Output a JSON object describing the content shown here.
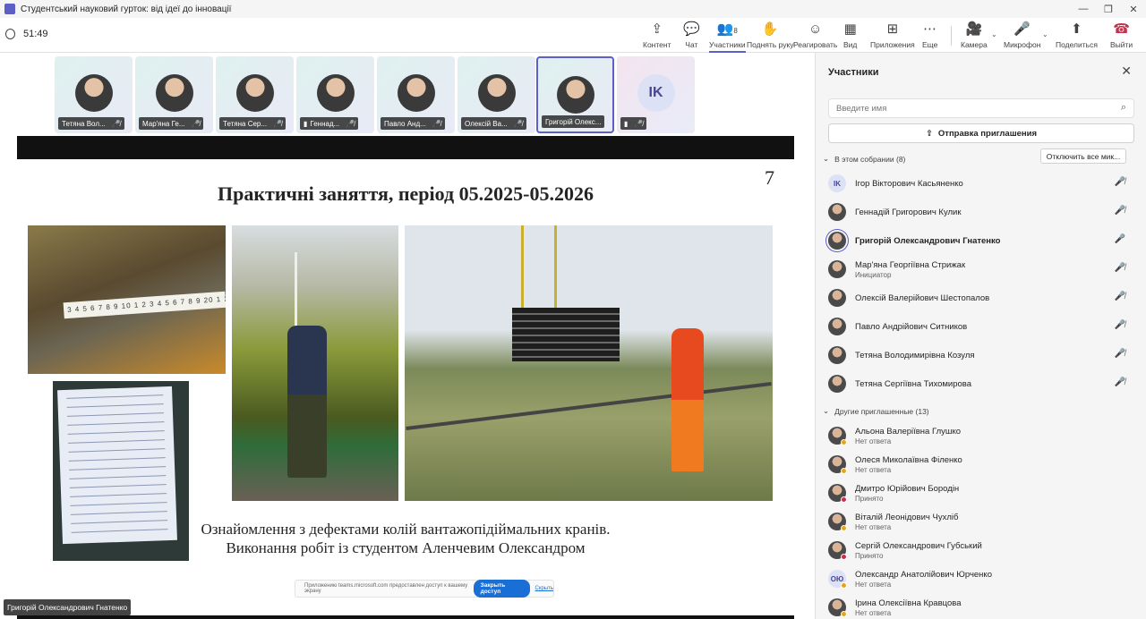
{
  "window": {
    "title": "Студентський науковий гурток: від ідеї до інновації",
    "controls": [
      "—",
      "❐",
      "✕"
    ]
  },
  "toolbar": {
    "timer": "51:49",
    "buttons": [
      {
        "label": "Контент",
        "icon": "⇪"
      },
      {
        "label": "Чат",
        "icon": "💬"
      },
      {
        "label": "Участники",
        "icon": "👥",
        "badge": "8"
      },
      {
        "label": "Поднять руку",
        "icon": "✋"
      },
      {
        "label": "Реагировать",
        "icon": "☺"
      },
      {
        "label": "Вид",
        "icon": "▦"
      },
      {
        "label": "Приложения",
        "icon": "⊞"
      },
      {
        "label": "Еще",
        "icon": "⋯"
      },
      {
        "label": "Камера",
        "icon": "🎥"
      },
      {
        "label": "Микрофон",
        "icon": "🎤"
      },
      {
        "label": "Поделиться",
        "icon": "⬆"
      },
      {
        "label": "Выйти",
        "icon": "☎"
      }
    ]
  },
  "video_strip": {
    "tiles": [
      {
        "name": "Тетяна Вол...",
        "muted": true
      },
      {
        "name": "Мар'яна Ге...",
        "muted": true
      },
      {
        "name": "Тетяна Сер...",
        "muted": true
      },
      {
        "name": "Геннад...",
        "muted": true,
        "signal": true
      },
      {
        "name": "Павло Анд...",
        "muted": true
      },
      {
        "name": "Олексій Ва...",
        "muted": true
      },
      {
        "name": "Григорій Олекс...",
        "muted": false,
        "active": true
      },
      {
        "name": "",
        "initials": "IK",
        "muted": true,
        "signal": true
      }
    ]
  },
  "slide": {
    "page_number": "7",
    "heading": "Практичні заняття, період 05.2025-05.2026",
    "tape_text": "3 4 5 6 7 8 9 10 1 2 3 4 5 6 7 8 9 20 1 2 3",
    "caption_line1": "Ознайомлення з дефектами колій вантажопідіймальних кранів.",
    "caption_line2": "Виконання робіт із студентом Аленчевим Олександром"
  },
  "share_bar": {
    "text": "Приложению teams.microsoft.com предоставлен доступ к вашему экрану",
    "stop_label": "Закрыть доступ",
    "hide_label": "Скрыть"
  },
  "presenter": "Григорій Олександрович Гнатенко",
  "panel": {
    "title": "Участники",
    "search_placeholder": "Введите имя",
    "invite_label": "Отправка приглашения",
    "mute_all_label": "Отключить все мик...",
    "in_meeting_label": "В этом собрании (8)",
    "others_label": "Другие приглашенные (13)",
    "in_meeting": [
      {
        "name": "Ігор Вікторович Касьяненко",
        "initials": "IK",
        "mic": "muted"
      },
      {
        "name": "Геннадій Григорович Кулик",
        "mic": "muted"
      },
      {
        "name": "Григорій Олександрович Гнатенко",
        "mic": "on",
        "bold": true,
        "speaking": true
      },
      {
        "name": "Мар'яна Георгіївна Стрижак",
        "role": "Инициатор",
        "mic": "muted"
      },
      {
        "name": "Олексій Валерійович Шестопалов",
        "mic": "muted"
      },
      {
        "name": "Павло Андрійович Ситников",
        "mic": "muted"
      },
      {
        "name": "Тетяна Володимирівна Козуля",
        "mic": "muted"
      },
      {
        "name": "Тетяна Сергіївна Тихомирова",
        "mic": "muted"
      }
    ],
    "others": [
      {
        "name": "Альона Валеріївна Глушко",
        "status": "Нет ответа",
        "dot": "#e8a317"
      },
      {
        "name": "Олеся Миколаївна Філенко",
        "status": "Нет ответа",
        "dot": "#e8a317"
      },
      {
        "name": "Дмитро Юрійович Бородін",
        "status": "Принято",
        "dot": "#c4314b"
      },
      {
        "name": "Віталій Леонідович Чухліб",
        "status": "Нет ответа",
        "dot": "#e8a317"
      },
      {
        "name": "Сергій Олександрович Губський",
        "status": "Принято",
        "dot": "#c4314b"
      },
      {
        "name": "Олександр Анатолійович Юрченко",
        "status": "Нет ответа",
        "initials": "ОЮ",
        "dot": "#e8a317"
      },
      {
        "name": "Ірина Олексіївна Кравцова",
        "status": "Нет ответа",
        "dot": "#e8a317"
      }
    ]
  },
  "colors": {
    "accent": "#5b5fc7",
    "leave": "#c4314b",
    "status_busy": "#c4314b",
    "status_away": "#e8a317"
  }
}
